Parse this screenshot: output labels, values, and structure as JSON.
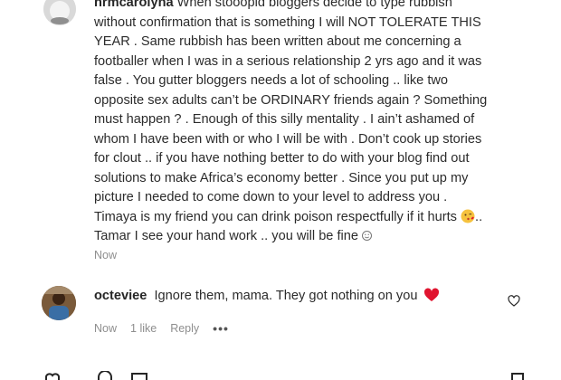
{
  "comments": [
    {
      "username": "hrmcarolyna",
      "lines": [
        "When stooopid bloggers decide to type rubbish",
        "without confirmation that is something I will NOT TOLERATE THIS",
        "YEAR . Same rubbish has been written about me concerning a",
        "footballer when I was in a serious relationship 2 yrs ago and it was",
        "false . You gutter bloggers needs a lot of schooling .. like two",
        "opposite sex adults can’t be ORDINARY friends again ? Something",
        "must happen ? . Enough of this silly mentality . I ain’t ashamed of",
        "whom I have been with or who I will be with . Don’t cook up stories",
        "for clout .. if you have nothing better to do with your blog find out",
        "solutions to make Africa’s economy better . Since you put up my",
        "picture I needed to come down to your level to address you .",
        "Timaya is my friend you can drink poison respectfully if it hurts",
        "..",
        "Tamar I see your hand work .. you will be fine"
      ],
      "time": "Now"
    },
    {
      "username": "octeviee",
      "text": "Ignore them, mama. They got nothing on you",
      "time": "Now",
      "likes": "1 like",
      "reply_label": "Reply",
      "more_label": "•••"
    }
  ],
  "icons": {
    "avatar_1": "avatar",
    "avatar_2": "avatar",
    "kiss_emoji": "kissing-face-emoji",
    "smile_emoji": "smiling-face-emoji",
    "heart_emoji": "red-heart-emoji",
    "like": "heart-outline-icon"
  },
  "colors": {
    "text": "#262626",
    "muted": "#8e8e8e",
    "heart": "#e0142f"
  }
}
